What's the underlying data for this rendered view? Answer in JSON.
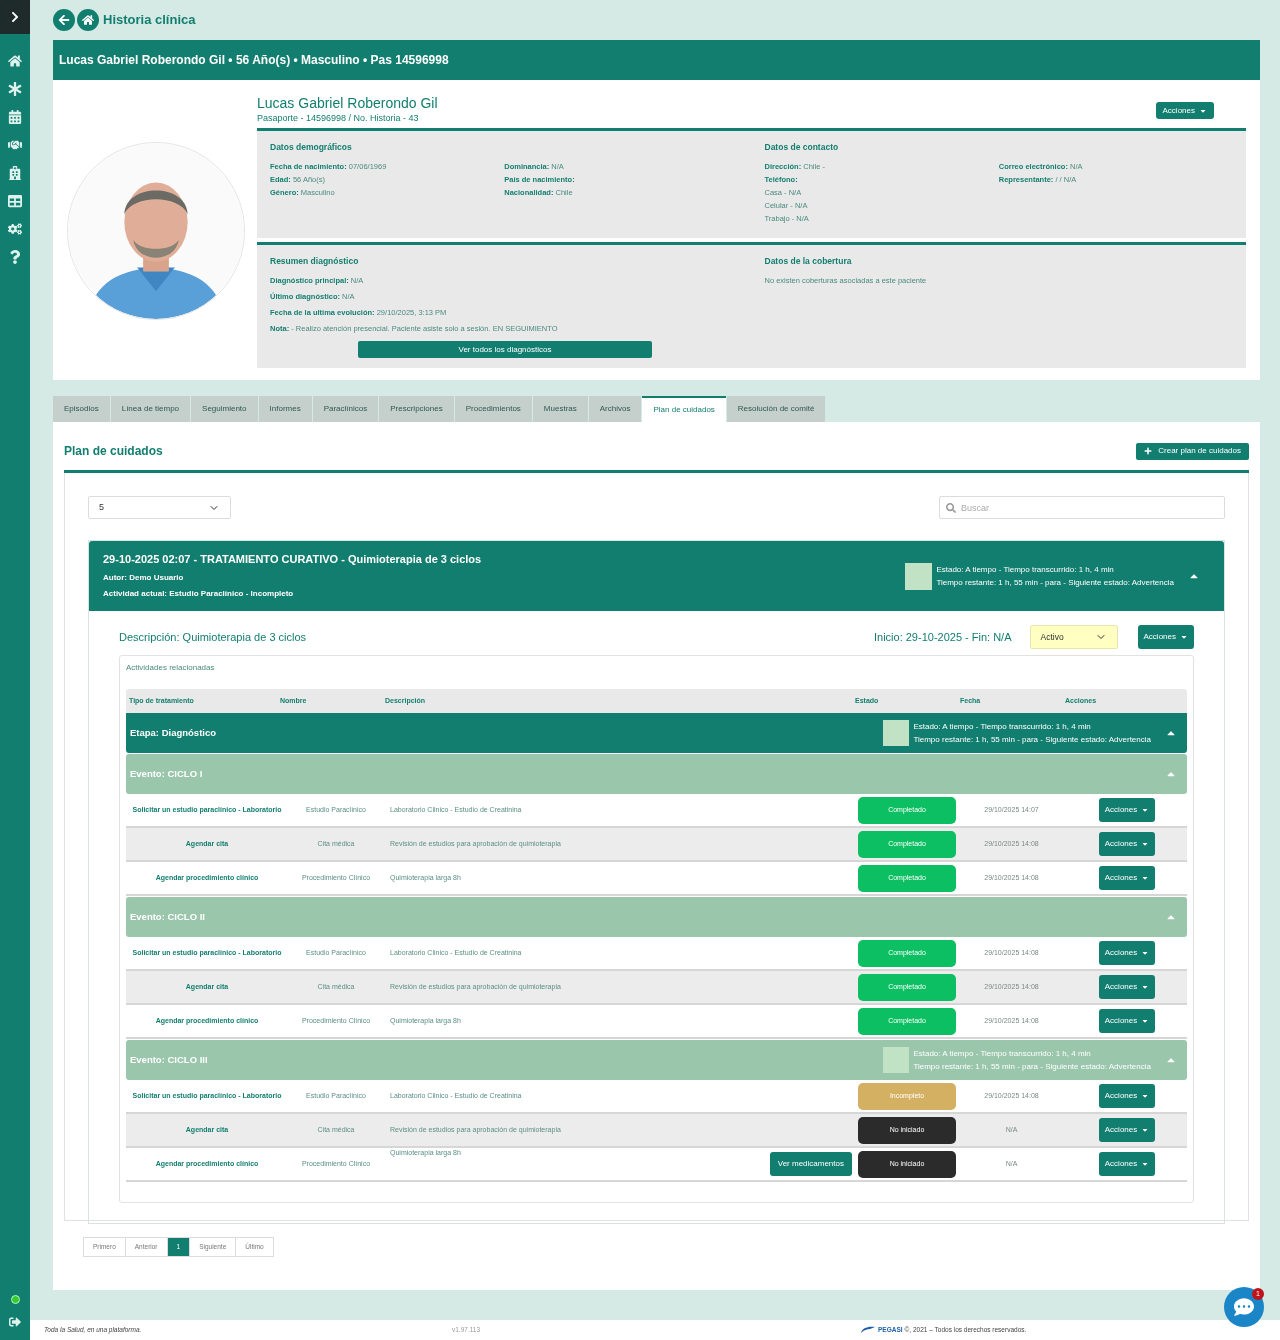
{
  "page_title": "Historia clínica",
  "patient_banner": "Lucas Gabriel Roberondo Gil • 56 Año(s) • Masculino • Pas 14596998",
  "patient": {
    "name": "Lucas Gabriel Roberondo Gil",
    "id_line": "Pasaporte - 14596998 / No. Historia - 43",
    "actions_button": "Acciones"
  },
  "info_blocks": [
    {
      "sections": [
        {
          "title": "Datos demográficos",
          "columns": [
            [
              {
                "label": "Fecha de nacimiento:",
                "value": "07/06/1969"
              },
              {
                "label": "Edad:",
                "value": "56 Año(s)"
              },
              {
                "label": "Género:",
                "value": "Masculino"
              }
            ],
            [
              {
                "label": "Dominancia:",
                "value": "N/A"
              },
              {
                "label": "País de nacimiento:"
              },
              {
                "label": "Nacionalidad:",
                "value": "Chile"
              }
            ]
          ]
        },
        {
          "title": "Datos de contacto",
          "columns": [
            [
              {
                "label": "Dirección:",
                "value": "Chile -"
              },
              {
                "label": "Teléfono:"
              },
              {
                "value": "Casa - N/A"
              },
              {
                "value": "Celular - N/A"
              },
              {
                "value": "Trabajo - N/A"
              }
            ],
            [
              {
                "label": "Correo electrónico:",
                "value": "N/A"
              },
              {
                "label": "Representante:",
                "value": "/ / N/A"
              }
            ]
          ]
        }
      ]
    },
    {
      "sections": [
        {
          "title": "Resumen diagnóstico",
          "columns": [
            [
              {
                "label": "Diagnóstico principal:",
                "value": "N/A"
              },
              {
                "label": "Último diagnóstico:",
                "value": "N/A"
              },
              {
                "label": "Fecha de la ultima evolución:",
                "value": "29/10/2025, 3:13 PM"
              },
              {
                "label": "Nota:",
                "value": "- Realizo atención presencial. Paciente asiste solo a sesión. EN SEGUIMIENTO"
              }
            ]
          ],
          "button": "Ver todos los diagnósticos"
        },
        {
          "title": "Datos de la cobertura",
          "columns": [
            [
              {
                "value": "No existen coberturas asociadas a este paciente"
              }
            ]
          ]
        }
      ]
    }
  ],
  "tabs": [
    {
      "label": "Episodios",
      "selected": false
    },
    {
      "label": "Línea de tiempo",
      "selected": false
    },
    {
      "label": "Seguimiento",
      "selected": false
    },
    {
      "label": "Informes",
      "selected": false
    },
    {
      "label": "Paraclínicos",
      "selected": false
    },
    {
      "label": "Prescripciones",
      "selected": false
    },
    {
      "label": "Procedimientos",
      "selected": false
    },
    {
      "label": "Muestras",
      "selected": false
    },
    {
      "label": "Archivos",
      "selected": false
    },
    {
      "label": "Plan de cuidados",
      "selected": true
    },
    {
      "label": "Resolución de comité",
      "selected": false
    }
  ],
  "care_plans": {
    "title": "Plan de cuidados",
    "create_button": "Crear plan de cuidados",
    "page_size": "5",
    "search": {
      "placeholder": "Buscar"
    }
  },
  "plan": {
    "heading": "29-10-2025 02:07 - TRATAMIENTO CURATIVO - Quimioterapia de 3 ciclos",
    "author": "Autor: Demo Usuario",
    "current_activity": "Actividad actual: Estudio Paraclínico - Incompleto",
    "status_lines": [
      "Estado: A tiempo - Tiempo transcurrido: 1 h, 4 min",
      "Tiempo restante: 1 h, 55 min - para - Siguiente estado: Advertencia"
    ],
    "expanded": true,
    "description": "Descripción: Quimioterapia de 3 ciclos",
    "dates": "Inicio: 29-10-2025 - Fin: N/A",
    "state": "Activo",
    "actions_button": "Acciones"
  },
  "activities": {
    "caption": "Actividades relacionadas",
    "columns": [
      "Tipo de tratamiento",
      "Nombre",
      "Descripción",
      "Estado",
      "Fecha",
      "Acciones"
    ],
    "stage": {
      "title": "Etapa: Diagnóstico",
      "status_lines": [
        "Estado: A tiempo - Tiempo transcurrido: 1 h, 4 min",
        "Tiempo restante: 1 h, 55 min - para - Siguiente estado: Advertencia"
      ],
      "expanded": true
    },
    "events": [
      {
        "title": "Evento: CICLO I",
        "expanded": true,
        "rows": [
          {
            "type": "Solicitar un estudio paraclínico - Laboratorio",
            "name": "Estudio Paraclínico",
            "description": "Laboratorio Clinico - Estudio de Creatinina",
            "status": {
              "label": "Completado",
              "kind": "done"
            },
            "date": "29/10/2025 14:07",
            "action": "Acciones"
          },
          {
            "type": "Agendar cita",
            "name": "Cita médica",
            "description": "Revisión de estudios para aprobación de quimioterapia",
            "status": {
              "label": "Completado",
              "kind": "done"
            },
            "date": "29/10/2025 14:08",
            "action": "Acciones"
          },
          {
            "type": "Agendar procedimiento clínico",
            "name": "Procedimiento Clínico",
            "description": "Quimioterapia larga 8h",
            "status": {
              "label": "Completado",
              "kind": "done"
            },
            "date": "29/10/2025 14:08",
            "action": "Acciones"
          }
        ]
      },
      {
        "title": "Evento: CICLO II",
        "expanded": true,
        "rows": [
          {
            "type": "Solicitar un estudio paraclínico - Laboratorio",
            "name": "Estudio Paraclínico",
            "description": "Laboratorio Clinico - Estudio de Creatinina",
            "status": {
              "label": "Completado",
              "kind": "done"
            },
            "date": "29/10/2025 14:08",
            "action": "Acciones"
          },
          {
            "type": "Agendar cita",
            "name": "Cita médica",
            "description": "Revisión de estudios para aprobación de quimioterapia",
            "status": {
              "label": "Completado",
              "kind": "done"
            },
            "date": "29/10/2025 14:08",
            "action": "Acciones"
          },
          {
            "type": "Agendar procedimiento clínico",
            "name": "Procedimiento Clínico",
            "description": "Quimioterapia larga 8h",
            "status": {
              "label": "Completado",
              "kind": "done"
            },
            "date": "29/10/2025 14:08",
            "action": "Acciones"
          }
        ]
      },
      {
        "title": "Evento: CICLO III",
        "expanded": true,
        "status_lines": [
          "Estado: A tiempo - Tiempo transcurrido: 1 h, 4 min",
          "Tiempo restante: 1 h, 55 min - para - Siguiente estado: Advertencia"
        ],
        "rows": [
          {
            "type": "Solicitar un estudio paraclínico - Laboratorio",
            "name": "Estudio Paraclínico",
            "description": "Laboratorio Clinico - Estudio de Creatinina",
            "status": {
              "label": "Incompleto",
              "kind": "incomplete"
            },
            "date": "29/10/2025 14:08",
            "action": "Acciones"
          },
          {
            "type": "Agendar cita",
            "name": "Cita médica",
            "description": "Revisión de estudios para aprobación de quimioterapia",
            "status": {
              "label": "No iniciado",
              "kind": "pending"
            },
            "date": "N/A",
            "action": "Acciones"
          },
          {
            "type": "Agendar procedimiento clínico",
            "name": "Procedimiento Clínico",
            "description": "Quimioterapia larga 8h",
            "extra_button": "Ver medicamentos",
            "status": {
              "label": "No iniciado",
              "kind": "pending"
            },
            "date": "N/A",
            "action": "Acciones"
          }
        ]
      }
    ]
  },
  "pagination": [
    {
      "label": "Primero",
      "selected": false
    },
    {
      "label": "Anterior",
      "selected": false
    },
    {
      "label": "1",
      "selected": true
    },
    {
      "label": "Siguiente",
      "selected": false
    },
    {
      "label": "Último",
      "selected": false
    }
  ],
  "chat_badge": "1",
  "footer": {
    "tagline": "Toda la Salud, en una plataforma.",
    "version": "v1.97.113",
    "logo": "PEGASI",
    "copyright": "©, 2021 – Todos los derechos reservados."
  }
}
